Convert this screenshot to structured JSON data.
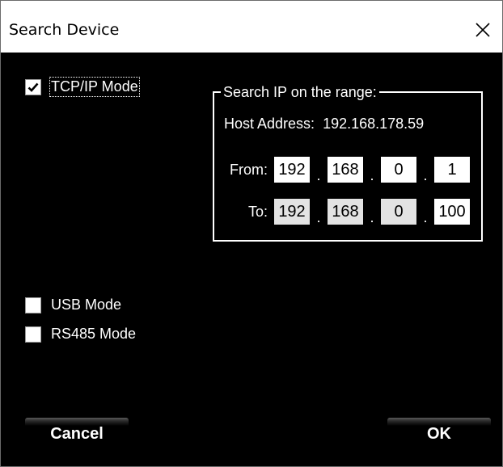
{
  "window": {
    "title": "Search Device",
    "close_glyph": "close-icon"
  },
  "modes": {
    "tcpip": {
      "label": "TCP/IP Mode",
      "checked": true
    },
    "usb": {
      "label": "USB Mode",
      "checked": false
    },
    "rs485": {
      "label": "RS485 Mode",
      "checked": false
    }
  },
  "search_range": {
    "legend": "Search IP on the range:",
    "host_label": "Host Address:",
    "host_value": "192.168.178.59",
    "from_label": "From:",
    "from": [
      "192",
      "168",
      "0",
      "1"
    ],
    "to_label": "To:",
    "to": [
      "192",
      "168",
      "0",
      "100"
    ]
  },
  "buttons": {
    "cancel": "Cancel",
    "ok": "OK"
  },
  "colors": {
    "background": "#000000",
    "titlebar": "#ffffff",
    "text": "#ffffff",
    "disabled_field": "#e3e3e3"
  }
}
